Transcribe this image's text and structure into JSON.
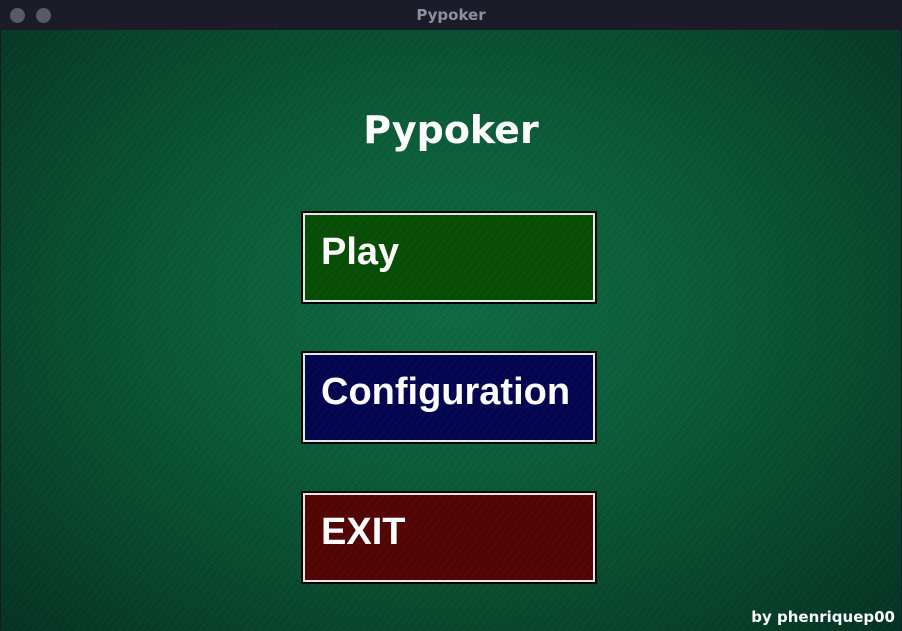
{
  "window": {
    "title": "Pypoker"
  },
  "main": {
    "title": "Pypoker",
    "buttons": {
      "play": "Play",
      "configuration": "Configuration",
      "exit": "EXIT"
    },
    "credit": "by phenriquep00"
  },
  "colors": {
    "felt": "#0a5c39",
    "play": "#054d03",
    "configuration": "#02034f",
    "exit": "#520303",
    "text": "#ffffff"
  }
}
